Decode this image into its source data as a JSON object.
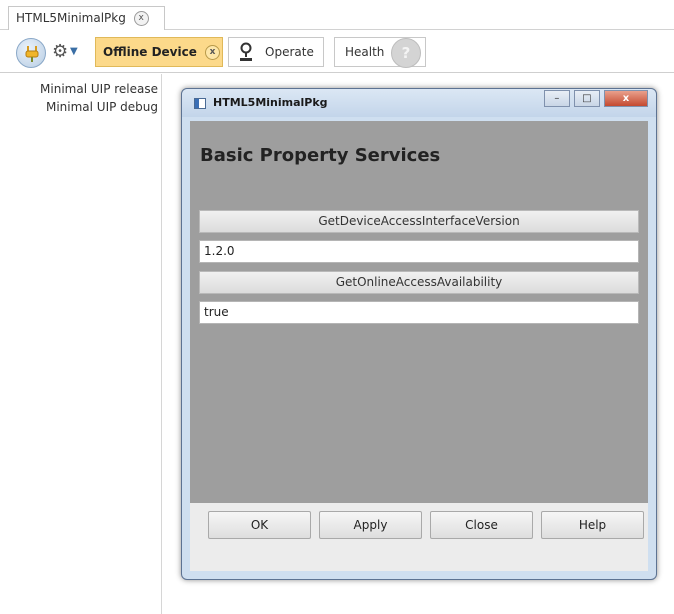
{
  "tabstrip": {
    "doc_tab_label": "HTML5MinimalPkg",
    "doc_tab_close": "x"
  },
  "toolbar": {
    "offline_label": "Offline Device",
    "offline_close": "x",
    "operate_label": "Operate",
    "health_label": "Health",
    "health_help_glyph": "?"
  },
  "tree": {
    "items": [
      {
        "label": "Minimal UIP release"
      },
      {
        "label": "Minimal UIP debug"
      }
    ]
  },
  "dialog": {
    "title": "HTML5MinimalPkg",
    "window_buttons": {
      "minimize": "–",
      "maximize": "□",
      "close": "x"
    },
    "heading": "Basic Property Services",
    "functions": [
      {
        "button_label": "GetDeviceAccessInterfaceVersion",
        "value": "1.2.0"
      },
      {
        "button_label": "GetOnlineAccessAvailability",
        "value": "true"
      }
    ],
    "footer_buttons": {
      "ok": "OK",
      "apply": "Apply",
      "close": "Close",
      "help": "Help"
    }
  },
  "colors": {
    "offline_tab_bg": "#fcd98a",
    "dialog_content_bg": "#9e9e9e",
    "dialog_frame": "#cfdff0",
    "close_button": "#c44a30"
  },
  "icons": [
    "connection-icon",
    "gear-icon",
    "chevron-down-icon",
    "pin-icon",
    "help-icon",
    "window-icon"
  ]
}
